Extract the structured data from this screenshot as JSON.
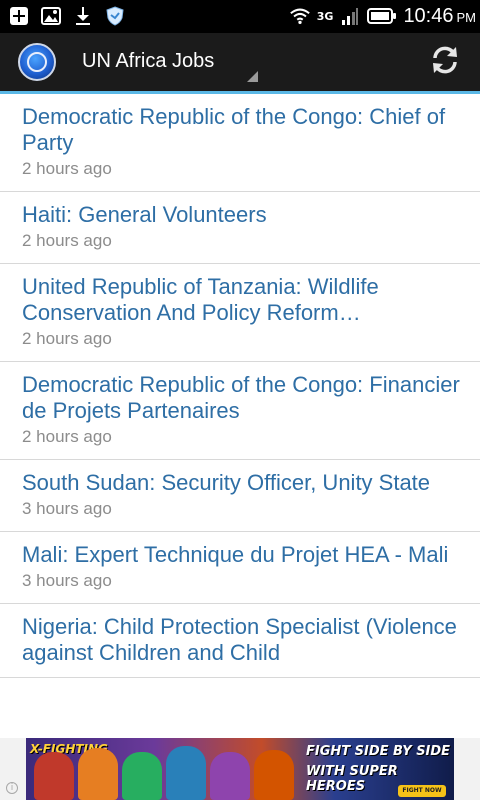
{
  "status_bar": {
    "left_icons": [
      "add-box-icon",
      "image-icon",
      "download-icon",
      "shield-icon"
    ],
    "network_type": "3G",
    "time": "10:46",
    "time_suffix": "PM"
  },
  "action_bar": {
    "title": "UN Africa Jobs",
    "logo_icon": "un-logo-icon",
    "refresh_icon": "refresh-icon",
    "accent_color": "#5bb8e6"
  },
  "jobs": [
    {
      "title": "Democratic Republic of the Congo: Chief of Party",
      "time": "2 hours ago"
    },
    {
      "title": "Haiti: General Volunteers",
      "time": "2 hours ago"
    },
    {
      "title": "United Republic of Tanzania: Wildlife Conservation And Policy Reform…",
      "time": "2 hours ago"
    },
    {
      "title": "Democratic Republic of the Congo: Financier de Projets Partenaires",
      "time": "2 hours ago"
    },
    {
      "title": "South Sudan: Security Officer, Unity State",
      "time": "3 hours ago"
    },
    {
      "title": "Mali: Expert Technique du Projet HEA - Mali",
      "time": "3 hours ago"
    },
    {
      "title": "Nigeria: Child Protection Specialist (Violence against Children and Child",
      "time": ""
    }
  ],
  "ad": {
    "brand": "X-FIGHTING",
    "line1": "FIGHT SIDE BY SIDE",
    "line2": "WITH SUPER HEROES",
    "cta": "FIGHT NOW",
    "info_icon": "info-icon"
  },
  "colors": {
    "link_blue": "#2e6ea5",
    "meta_gray": "#8c8c8c",
    "divider": "#d8d8d8"
  }
}
